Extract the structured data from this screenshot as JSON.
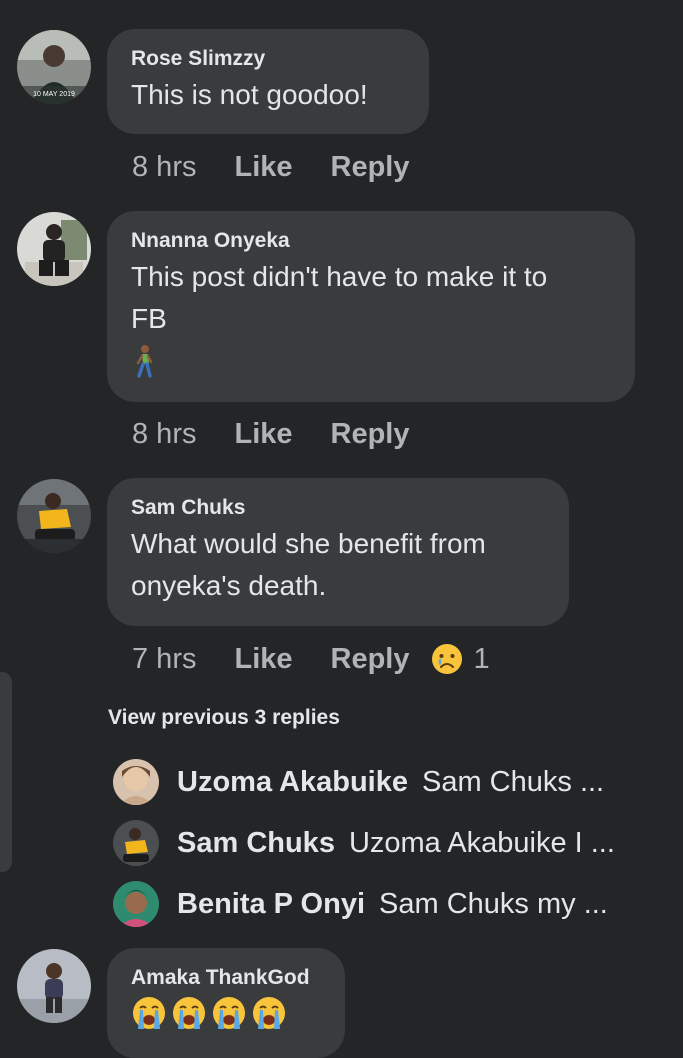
{
  "comments": [
    {
      "author": "Rose Slimzzy",
      "text": "This is not goodoo!",
      "time": "8 hrs",
      "like": "Like",
      "reply": "Reply",
      "avatar_caption": "10 MAY 2019"
    },
    {
      "author": "Nnanna Onyeka",
      "text_lines": [
        "This post didn't have to make it to",
        "FB"
      ],
      "emoji": "person-walking",
      "time": "8 hrs",
      "like": "Like",
      "reply": "Reply"
    },
    {
      "author": "Sam Chuks",
      "text_lines": [
        "What would she benefit from",
        "onyeka's death."
      ],
      "time": "7 hrs",
      "like": "Like",
      "reply": "Reply",
      "reaction": "sad-face",
      "reaction_count": "1"
    },
    {
      "author": "Amaka ThankGod",
      "emoji": "loudly-crying-face",
      "emoji_count": 4
    }
  ],
  "replies": {
    "view_previous": "View previous 3 replies",
    "items": [
      {
        "name": "Uzoma Akabuike",
        "text": "Sam Chuks ..."
      },
      {
        "name": "Sam Chuks",
        "text": "Uzoma Akabuike I ..."
      },
      {
        "name": "Benita P Onyi",
        "text": "Sam Chuks my ..."
      }
    ]
  },
  "colors": {
    "background": "#242526",
    "bubble": "#3a3b3c",
    "primary_text": "#e4e6eb",
    "secondary_text": "#b0b3b8"
  }
}
